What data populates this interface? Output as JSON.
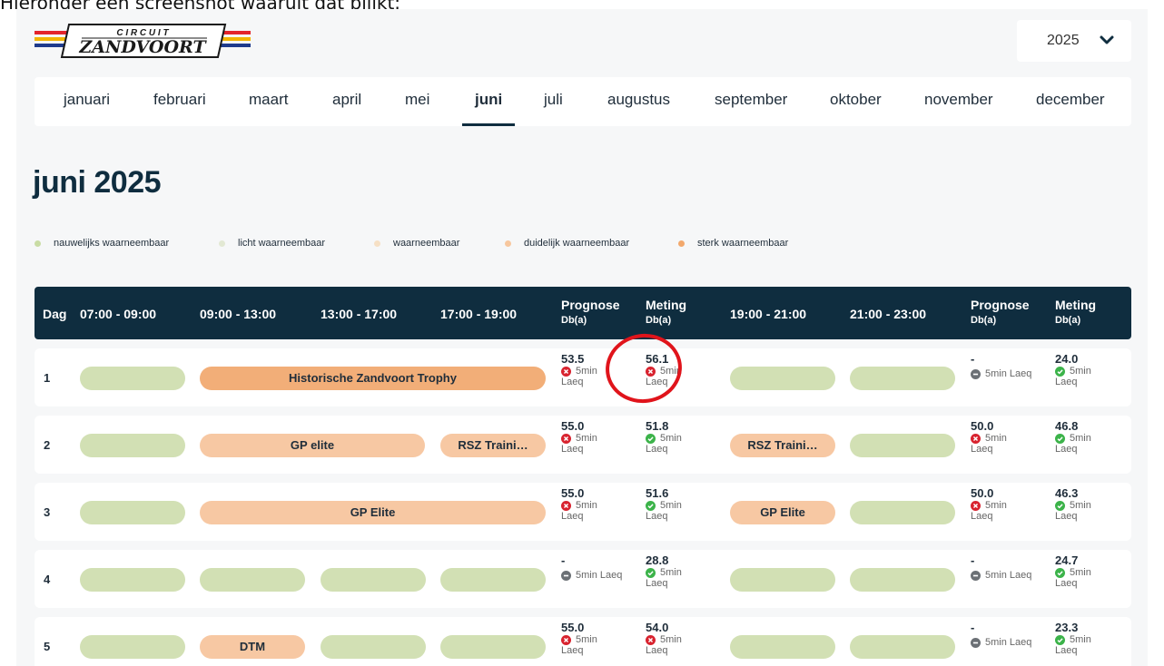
{
  "caption": "Hieronder een screenshot waaruit dat blijkt:",
  "header": {
    "logo_top": "C I R C U I T",
    "logo_main": "ZANDVOORT",
    "year": "2025"
  },
  "months": [
    {
      "label": "januari",
      "active": false
    },
    {
      "label": "februari",
      "active": false
    },
    {
      "label": "maart",
      "active": false
    },
    {
      "label": "april",
      "active": false
    },
    {
      "label": "mei",
      "active": false
    },
    {
      "label": "juni",
      "active": true
    },
    {
      "label": "juli",
      "active": false
    },
    {
      "label": "augustus",
      "active": false
    },
    {
      "label": "september",
      "active": false
    },
    {
      "label": "oktober",
      "active": false
    },
    {
      "label": "november",
      "active": false
    },
    {
      "label": "december",
      "active": false
    }
  ],
  "page_title": "juni 2025",
  "legend": [
    {
      "label": "nauwelijks waarneembaar",
      "color": "#c9dca4"
    },
    {
      "label": "licht waarneembaar",
      "color": "#e2e8d3"
    },
    {
      "label": "waarneembaar",
      "color": "#f6e0c5"
    },
    {
      "label": "duidelijk waarneembaar",
      "color": "#f7c79e"
    },
    {
      "label": "sterk waarneembaar",
      "color": "#f2a86c"
    }
  ],
  "table": {
    "headers": {
      "dag": "Dag",
      "t1": "07:00 - 09:00",
      "t2": "09:00 - 13:00",
      "t3": "13:00 - 17:00",
      "t4": "17:00 - 19:00",
      "prognose1": "Prognose",
      "prognose1_unit": "Db(a)",
      "meting1": "Meting",
      "meting1_unit": "Db(a)",
      "t5": "19:00 - 21:00",
      "t6": "21:00 - 23:00",
      "prognose2": "Prognose",
      "prognose2_unit": "Db(a)",
      "meting2": "Meting",
      "meting2_unit": "Db(a)"
    },
    "rows": [
      {
        "day": "1",
        "prog1": "53.5",
        "prog1_status": "red",
        "prog1_text": "5min",
        "prog1_unit": "Laeq",
        "met1": "56.1",
        "met1_status": "red",
        "met1_text": "5min",
        "met1_unit": "Laeq",
        "prog2": "-",
        "prog2_status": "grey",
        "prog2_text": "5min Laeq",
        "prog2_unit": "",
        "met2": "24.0",
        "met2_status": "green",
        "met2_text": "5min",
        "met2_unit": "Laeq",
        "event_a": "Historische Zandvoort Trophy"
      },
      {
        "day": "2",
        "prog1": "55.0",
        "prog1_status": "red",
        "prog1_text": "5min",
        "prog1_unit": "Laeq",
        "met1": "51.8",
        "met1_status": "green",
        "met1_text": "5min",
        "met1_unit": "Laeq",
        "prog2": "50.0",
        "prog2_status": "red",
        "prog2_text": "5min",
        "prog2_unit": "Laeq",
        "met2": "46.8",
        "met2_status": "green",
        "met2_text": "5min",
        "met2_unit": "Laeq",
        "event_a": "GP elite",
        "event_b": "RSZ Traini…",
        "event_c": "RSZ Traini…"
      },
      {
        "day": "3",
        "prog1": "55.0",
        "prog1_status": "red",
        "prog1_text": "5min",
        "prog1_unit": "Laeq",
        "met1": "51.6",
        "met1_status": "green",
        "met1_text": "5min",
        "met1_unit": "Laeq",
        "prog2": "50.0",
        "prog2_status": "red",
        "prog2_text": "5min",
        "prog2_unit": "Laeq",
        "met2": "46.3",
        "met2_status": "green",
        "met2_text": "5min",
        "met2_unit": "Laeq",
        "event_a": "GP Elite",
        "event_c": "GP Elite"
      },
      {
        "day": "4",
        "prog1": "-",
        "prog1_status": "grey",
        "prog1_text": "5min Laeq",
        "prog1_unit": "",
        "met1": "28.8",
        "met1_status": "green",
        "met1_text": "5min",
        "met1_unit": "Laeq",
        "prog2": "-",
        "prog2_status": "grey",
        "prog2_text": "5min Laeq",
        "prog2_unit": "",
        "met2": "24.7",
        "met2_status": "green",
        "met2_text": "5min",
        "met2_unit": "Laeq"
      },
      {
        "day": "5",
        "prog1": "55.0",
        "prog1_status": "red",
        "prog1_text": "5min",
        "prog1_unit": "Laeq",
        "met1": "54.0",
        "met1_status": "red",
        "met1_text": "5min",
        "met1_unit": "Laeq",
        "prog2": "-",
        "prog2_status": "grey",
        "prog2_text": "5min Laeq",
        "prog2_unit": "",
        "met2": "23.3",
        "met2_status": "green",
        "met2_text": "5min",
        "met2_unit": "Laeq",
        "event_a": "DTM"
      }
    ]
  },
  "colors": {
    "header_bg": "#0f2d3f",
    "status_red": "#d8232f",
    "status_green": "#3cb34a",
    "status_grey": "#6b7075",
    "annotation_circle": "#e0141b"
  }
}
